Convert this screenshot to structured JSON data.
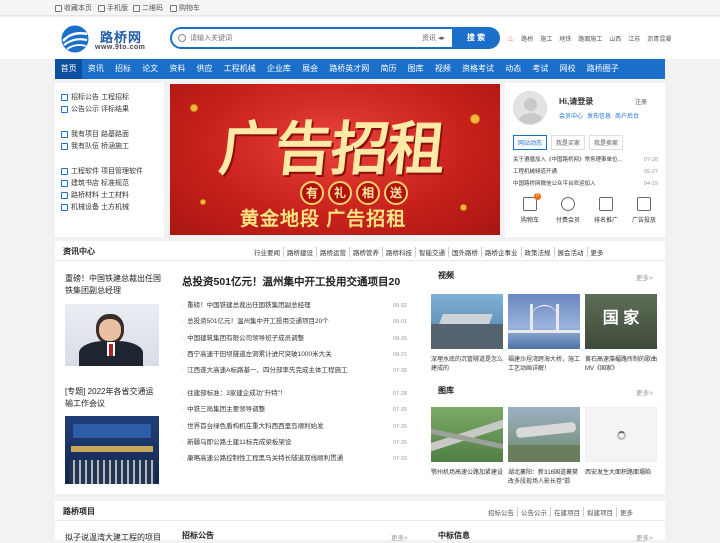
{
  "topbar": {
    "items": [
      {
        "label": "收藏本页",
        "icon": "star-icon"
      },
      {
        "label": "手机版",
        "icon": "phone-icon"
      },
      {
        "label": "二维码",
        "icon": "qrcode-icon"
      },
      {
        "label": "购物车",
        "icon": "cart-icon"
      }
    ]
  },
  "header": {
    "logo_name": "路桥网",
    "logo_url": "www.9to.com",
    "search_placeholder": "请输入关键词",
    "search_category": "资讯",
    "search_button": "搜 索",
    "hotwords": [
      "路桥",
      "施工",
      "地铁",
      "路面施工",
      "山西",
      "江苏",
      "沥青混凝"
    ]
  },
  "nav": [
    "首页",
    "资讯",
    "招标",
    "论文",
    "资料",
    "供应",
    "工程机械",
    "企业库",
    "展会",
    "路桥英才网",
    "简历",
    "图库",
    "视频",
    "资格考试",
    "动态",
    "考试",
    "网校",
    "路桥圈子"
  ],
  "left_links": [
    [
      "招标公告 工程招标",
      "公告公示 评标结果"
    ],
    [
      "我有项目 路基路面",
      "我有队伍 桥涵施工"
    ],
    [
      "工程软件 项目管理软件",
      "建筑书店 标准规范",
      "路桥材料 土工材料",
      "机械设备 土方机械"
    ]
  ],
  "banner": {
    "big": "广告招租",
    "pills": [
      "有",
      "礼",
      "相",
      "送"
    ],
    "sub": "黄金地段  广告招租"
  },
  "user": {
    "greeting": "Hi,请登录",
    "logout": "注册",
    "links": [
      "会员中心",
      "发布信息",
      "商户后台"
    ],
    "tabs": [
      "网站动态",
      "我是买家",
      "我是卖家"
    ],
    "news": [
      {
        "title": "关于遵循加入《中国路桥网》常务理事单位...",
        "date": "07-28"
      },
      {
        "title": "工程机械频道开通",
        "date": "05-27"
      },
      {
        "title": "中国路桥网微信公众平台欢迎加入",
        "date": "04-19"
      }
    ],
    "icons": [
      {
        "label": "购物车",
        "icon": "cart-icon",
        "badge": "0"
      },
      {
        "label": "付费会员",
        "icon": "vip-icon"
      },
      {
        "label": "排名推广",
        "icon": "rank-icon"
      },
      {
        "label": "广告投放",
        "icon": "ad-icon"
      }
    ]
  },
  "news_panel": {
    "title": "资讯中心",
    "tabs": [
      "行业要闻",
      "路桥建设",
      "路桥运营",
      "路桥管养",
      "路桥科技",
      "智能交通",
      "国外路桥",
      "路桥企事业",
      "政策法规",
      "展会活动",
      "更多"
    ],
    "left_cards": [
      "重磅！中国铁建总裁出任国铁集团副总经理",
      "[专题] 2022年各省交通运输工作会议"
    ],
    "headline": "总投资501亿元！温州集中开工投用交通项目20",
    "list1": [
      {
        "title": "重磅！中国铁建总裁出任国铁集团副总经理",
        "date": "09-02"
      },
      {
        "title": "总投资501亿元！温州集中开工投用交通项目20个",
        "date": "09-01"
      },
      {
        "title": "中国建筑集团有限公司领导班子成员调整",
        "date": "08-26"
      },
      {
        "title": "西宁高速干田坝隧道左洞累计进尺突破1000米大关",
        "date": "08-21"
      },
      {
        "title": "江西遂大高速A标路基一、四分部率先完成主体工程施工",
        "date": "07-28"
      }
    ],
    "list2": [
      {
        "title": "住建部标准：3家建企成功\"升特\"！",
        "date": "07-28"
      },
      {
        "title": "中铁三局集团主要领导调整",
        "date": "07-25"
      },
      {
        "title": "世界首台绿色盾构机在重大科西西里岛顺利始发",
        "date": "07-25"
      },
      {
        "title": "新疆乌即公路土建11标完成梁板架设",
        "date": "07-25"
      },
      {
        "title": "康略高速公路控制性工程黑马关特长隧道双线顺利贯通",
        "date": "07-23"
      }
    ],
    "video_title": "视频",
    "gallery_title": "图库",
    "more": "更多>",
    "videos": [
      {
        "caption": "深埋水底的沉管隧道是怎么建成的"
      },
      {
        "caption": "福建沙埕湾跨海大桥，施工工艺动画详解！"
      },
      {
        "caption": "黄石高速藻嵋路所制的歌曲MV《国家》",
        "overlay": "国 家"
      }
    ],
    "gallery": [
      {
        "caption": "鄂州机场高速公路加紧建设"
      },
      {
        "caption": "湖北襄阳：新316国道襄樊改多段现场人影长卷\"邯"
      },
      {
        "caption": "西安发生大面积路面塌陷"
      }
    ]
  },
  "bottom": {
    "title": "路桥项目",
    "tabs": [
      "招标公告",
      "公告公示",
      "在建项目",
      "拟建项目",
      "更多"
    ],
    "card": "拟子说温湾大建工程的项目",
    "col1": "招标公告",
    "col2": "中标信息",
    "more": "更多>"
  }
}
